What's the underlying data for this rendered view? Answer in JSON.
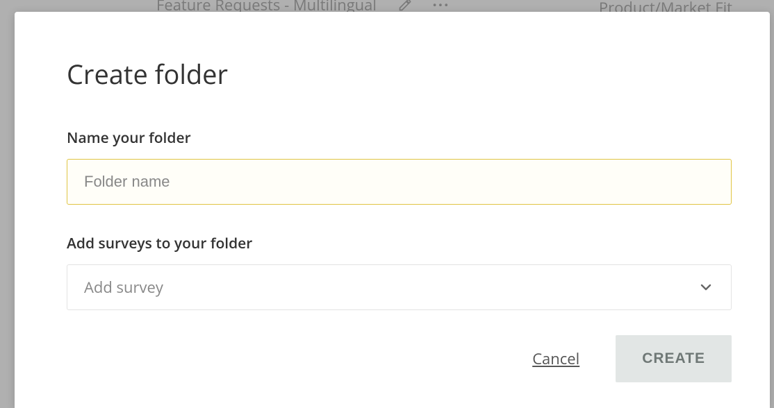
{
  "background": {
    "left_text": "Feature Requests - Multilingual",
    "right_text": "Product/Market Fit"
  },
  "modal": {
    "title": "Create folder",
    "name_field": {
      "label": "Name your folder",
      "placeholder": "Folder name",
      "value": ""
    },
    "survey_field": {
      "label": "Add surveys to your folder",
      "placeholder": "Add survey"
    },
    "actions": {
      "cancel": "Cancel",
      "create": "CREATE"
    }
  }
}
